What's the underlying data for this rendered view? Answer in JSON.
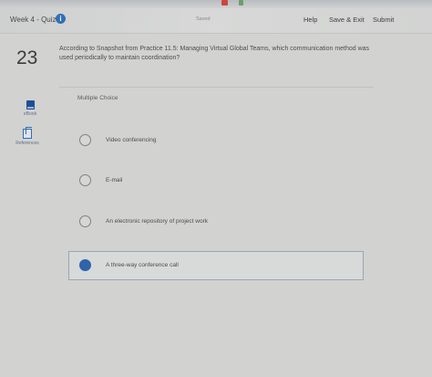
{
  "header": {
    "quiz_title": "Week 4 - Quiz",
    "saved_status": "Saved",
    "help_label": "Help",
    "save_exit_label": "Save & Exit",
    "submit_label": "Submit"
  },
  "sidebar": {
    "ebook_label": "eBook",
    "references_label": "References"
  },
  "question": {
    "number": "23",
    "text": "According to Snapshot from Practice 11.5: Managing Virtual Global Teams, which communication method was used periodically to maintain coordination?",
    "type_label": "Multiple Choice",
    "options": [
      {
        "label": "Video conferencing",
        "selected": false
      },
      {
        "label": "E-mail",
        "selected": false
      },
      {
        "label": "An electronic repository of project work",
        "selected": false
      },
      {
        "label": "A three-way conference call",
        "selected": true
      }
    ]
  },
  "colors": {
    "accent": "#2f63aa",
    "background": "#d2d2d0"
  }
}
